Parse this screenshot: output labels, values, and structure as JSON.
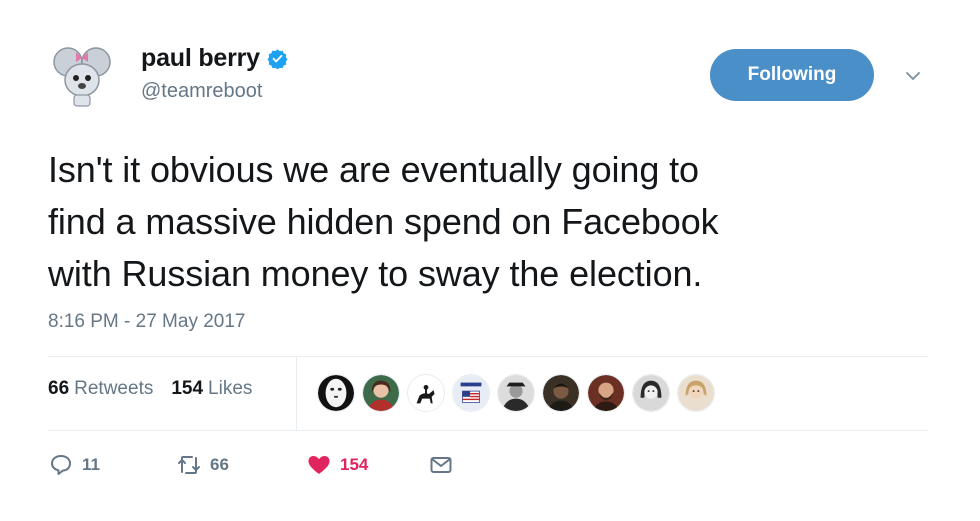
{
  "author": {
    "display_name": "paul berry",
    "handle": "@teamreboot",
    "verified": true,
    "avatar_icon": "mouse-cartoon-avatar"
  },
  "follow_button": {
    "label": "Following",
    "color": "#4a8fc8"
  },
  "tweet": {
    "lines": [
      "Isn't it obvious we are eventually going to",
      "find a massive hidden spend on Facebook",
      "with Russian money to sway the election."
    ],
    "timestamp": "8:16 PM - 27 May 2017"
  },
  "stats": {
    "retweets_count": "66",
    "retweets_label": "Retweets",
    "likes_count": "154",
    "likes_label": "Likes"
  },
  "likers": [
    {
      "icon": "no-face-avatar",
      "color": "#111111"
    },
    {
      "icon": "woman-red-avatar",
      "color": "#b2302c"
    },
    {
      "icon": "horse-rider-avatar",
      "color": "#1a1a1a"
    },
    {
      "icon": "boycott-flag-avatar",
      "color": "#e8edf5"
    },
    {
      "icon": "man-hat-avatar",
      "color": "#2a2a2a"
    },
    {
      "icon": "man-dark-avatar",
      "color": "#3b3026"
    },
    {
      "icon": "man-beard-avatar",
      "color": "#6b2f24"
    },
    {
      "icon": "woman-bw-avatar",
      "color": "#555555"
    },
    {
      "icon": "blonde-avatar",
      "color": "#c9a36a"
    }
  ],
  "actions": {
    "reply_count": "11",
    "retweet_count": "66",
    "like_count": "154",
    "like_color": "#e0245e"
  }
}
